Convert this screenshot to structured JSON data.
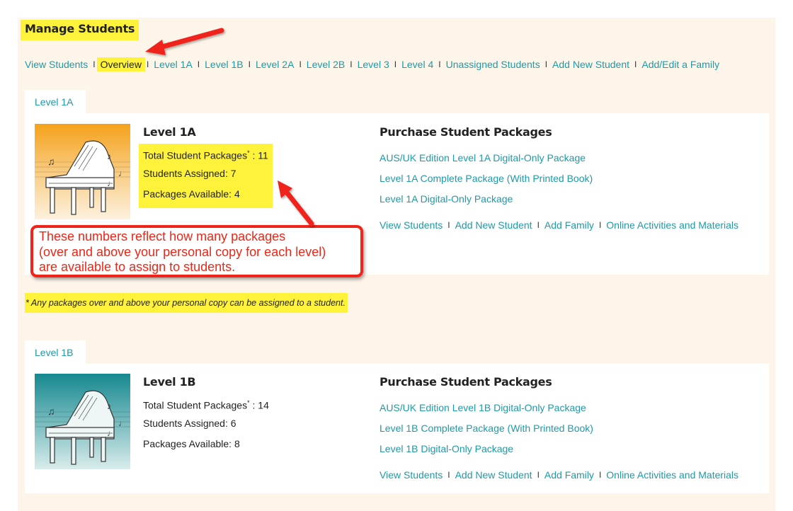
{
  "page": {
    "title": "Manage Students",
    "background_color": "#fdf5e9",
    "highlight_color": "#fff23a",
    "link_color": "#1e9aa8",
    "annotation_color": "#f0241a"
  },
  "nav": {
    "separator": "I",
    "items": [
      {
        "label": "View Students",
        "active": false
      },
      {
        "label": "Overview",
        "active": true
      },
      {
        "label": "Level 1A",
        "active": false
      },
      {
        "label": "Level 1B",
        "active": false
      },
      {
        "label": "Level 2A",
        "active": false
      },
      {
        "label": "Level 2B",
        "active": false
      },
      {
        "label": "Level 3",
        "active": false
      },
      {
        "label": "Level 4",
        "active": false
      },
      {
        "label": "Unassigned Students",
        "active": false
      },
      {
        "label": "Add New Student",
        "active": false
      },
      {
        "label": "Add/Edit a Family",
        "active": false
      }
    ]
  },
  "levels": [
    {
      "tab_label": "Level 1A",
      "title": "Level 1A",
      "image": "grand-piano-orange",
      "stats": {
        "total_label": "Total Student Packages",
        "total_marker": "*",
        "total_value": ": 11",
        "assigned": "Students Assigned: 7",
        "available": "Packages Available: 4"
      },
      "purchase": {
        "heading": "Purchase Student Packages",
        "packages": [
          "AUS/UK Edition Level 1A Digital-Only Package",
          "Level 1A Complete Package (With Printed Book)",
          "Level 1A Digital-Only Package"
        ],
        "links": [
          "View Students",
          "Add New Student",
          "Add Family",
          "Online Activities and Materials"
        ]
      }
    },
    {
      "tab_label": "Level 1B",
      "title": "Level 1B",
      "image": "grand-piano-teal",
      "stats": {
        "total_label": "Total Student Packages",
        "total_marker": "*",
        "total_value": ": 14",
        "assigned": "Students Assigned: 6",
        "available": "Packages Available: 8"
      },
      "purchase": {
        "heading": "Purchase Student Packages",
        "packages": [
          "AUS/UK Edition Level 1B Digital-Only Package",
          "Level 1B Complete Package (With Printed Book)",
          "Level 1B Digital-Only Package"
        ],
        "links": [
          "View Students",
          "Add New Student",
          "Add Family",
          "Online Activities and Materials"
        ]
      }
    }
  ],
  "footnote": "* Any packages over and above your personal copy can be assigned to a student.",
  "callout": {
    "lines": [
      "These numbers reflect how many packages",
      "(over and above your personal copy for each level)",
      "are available to assign to students."
    ]
  }
}
